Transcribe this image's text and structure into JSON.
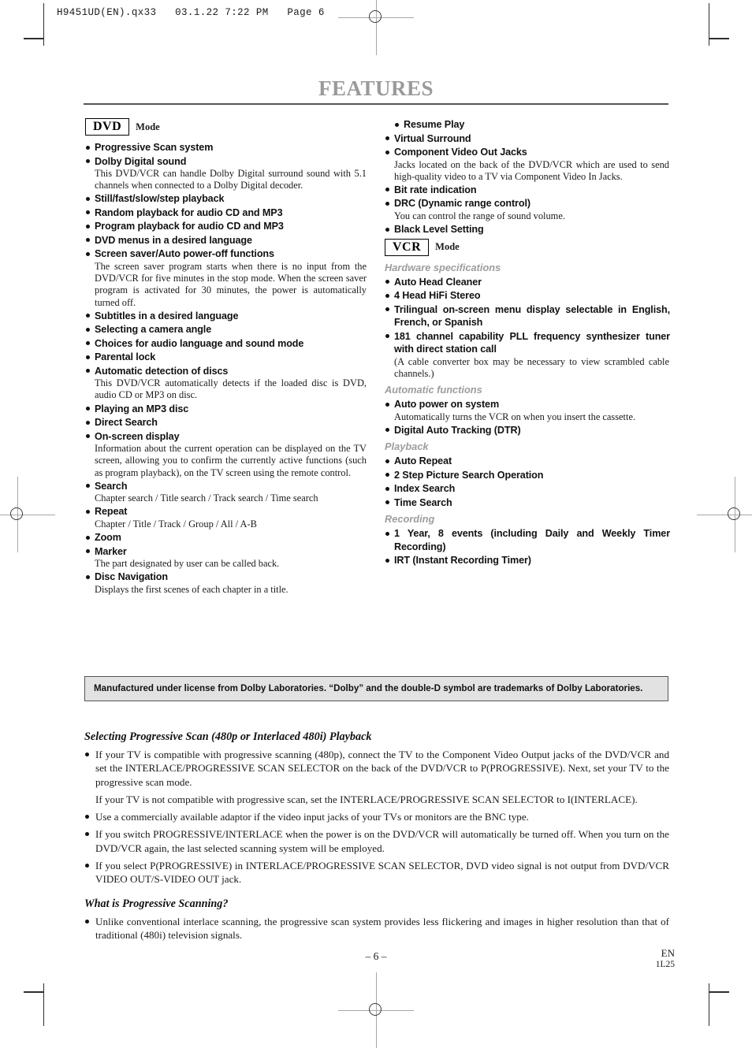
{
  "print_header": "H9451UD(EN).qx33   03.1.22 7:22 PM   Page 6",
  "page_title": "FEATURES",
  "colors": {
    "title_gray": "#9a9a9a",
    "group_label_gray": "#9d9d9d",
    "notice_bg": "#e2e2e2",
    "rule": "#555555"
  },
  "left_column": {
    "mode_badge": "DVD",
    "mode_word": "Mode",
    "items": [
      {
        "title": "Progressive Scan system"
      },
      {
        "title": "Dolby Digital sound",
        "desc": "This DVD/VCR can handle Dolby Digital surround sound with 5.1 channels when connected to a Dolby Digital decoder."
      },
      {
        "title": "Still/fast/slow/step playback"
      },
      {
        "title": "Random playback for audio CD and MP3"
      },
      {
        "title": "Program playback for audio CD and MP3"
      },
      {
        "title": "DVD menus in a desired language"
      },
      {
        "title": "Screen saver/Auto power-off functions",
        "desc": "The screen saver program starts when there is no input from the DVD/VCR for five minutes in the stop mode. When the screen saver program is activated for 30 minutes, the power is automatically turned off."
      },
      {
        "title": "Subtitles in a desired language"
      },
      {
        "title": "Selecting a camera angle"
      },
      {
        "title": "Choices for audio language and sound mode"
      },
      {
        "title": "Parental lock"
      },
      {
        "title": "Automatic detection of discs",
        "desc": "This DVD/VCR automatically detects if the loaded disc is DVD,  audio CD or MP3 on disc."
      },
      {
        "title": "Playing an MP3 disc"
      },
      {
        "title": "Direct Search"
      },
      {
        "title": "On-screen display",
        "desc": "Information about the current operation can be displayed on the TV screen, allowing you to confirm the currently active functions (such as program playback), on the TV screen using the remote control."
      },
      {
        "title": "Search",
        "desc": "Chapter search / Title search / Track search / Time search"
      },
      {
        "title": "Repeat",
        "desc": "Chapter / Title / Track / Group / All / A-B"
      },
      {
        "title": "Zoom"
      },
      {
        "title": "Marker",
        "desc": "The part designated by user can be called back."
      },
      {
        "title": "Disc Navigation",
        "desc": "Displays the first scenes of each chapter in a title."
      }
    ]
  },
  "right_column": {
    "dvd_continued": [
      {
        "title": "Resume Play",
        "indent": true
      },
      {
        "title": "Virtual Surround"
      },
      {
        "title": "Component Video Out Jacks",
        "desc": "Jacks located on the back of the DVD/VCR which are used to send high-quality video to a TV via Component Video In Jacks."
      },
      {
        "title": "Bit rate indication"
      },
      {
        "title": "DRC (Dynamic range control)",
        "desc": "You can control the range of sound volume."
      },
      {
        "title": "Black Level Setting"
      }
    ],
    "mode_badge": "VCR",
    "mode_word": "Mode",
    "groups": [
      {
        "label": "Hardware specifications",
        "items": [
          {
            "title": "Auto Head Cleaner"
          },
          {
            "title": "4 Head HiFi Stereo"
          },
          {
            "title": "Trilingual on-screen menu display selectable in English, French, or Spanish",
            "justify": true
          },
          {
            "title": "181 channel capability PLL frequency synthesizer tuner with direct station call",
            "justify": true,
            "desc": "(A cable converter box may be necessary to view scrambled cable channels.)"
          }
        ]
      },
      {
        "label": "Automatic functions",
        "items": [
          {
            "title": "Auto power on system",
            "desc": "Automatically turns the VCR on when you insert the cassette."
          },
          {
            "title": "Digital Auto Tracking (DTR)"
          }
        ]
      },
      {
        "label": "Playback",
        "items": [
          {
            "title": "Auto Repeat"
          },
          {
            "title": "2 Step Picture Search Operation"
          },
          {
            "title": "Index Search"
          },
          {
            "title": "Time Search"
          }
        ]
      },
      {
        "label": "Recording",
        "items": [
          {
            "title": "1 Year, 8 events (including Daily and Weekly Timer Recording)",
            "justify": true
          },
          {
            "title": "IRT (Instant Recording Timer)"
          }
        ]
      }
    ]
  },
  "dolby_notice": "Manufactured under license from Dolby Laboratories. “Dolby” and the double-D symbol are trademarks of Dolby Laboratories.",
  "progressive_section": {
    "heading": "Selecting Progressive Scan (480p or Interlaced 480i) Playback",
    "paragraphs": [
      {
        "bullet": true,
        "text": "If your TV is compatible with progressive scanning (480p), connect the TV to the Component Video Output jacks of the DVD/VCR and set the INTERLACE/PROGRESSIVE SCAN SELECTOR on the back of the DVD/VCR to P(PROGRESSIVE).  Next, set your TV to the progressive scan mode."
      },
      {
        "bullet": false,
        "text": "If your TV is not compatible with progressive scan, set the INTERLACE/PROGRESSIVE SCAN SELECTOR to I(INTERLACE)."
      },
      {
        "bullet": true,
        "text": "Use a commercially available adaptor if the video input jacks of your TVs or monitors are the BNC type."
      },
      {
        "bullet": true,
        "text": "If you switch PROGRESSIVE/INTERLACE when the power is on the DVD/VCR will automatically be turned off. When you turn on the DVD/VCR again, the last selected scanning system will be employed."
      },
      {
        "bullet": true,
        "text": "If you select P(PROGRESSIVE) in INTERLACE/PROGRESSIVE SCAN SELECTOR, DVD video signal is not output from DVD/VCR VIDEO OUT/S-VIDEO OUT jack."
      }
    ]
  },
  "what_is_section": {
    "heading": "What is Progressive Scanning?",
    "paragraphs": [
      {
        "bullet": true,
        "text": "Unlike conventional interlace scanning, the progressive scan system provides less flickering and images in higher resolution than that of traditional (480i) television signals."
      }
    ]
  },
  "footer": {
    "page_number": "– 6 –",
    "language_code": "EN",
    "doc_code": "1L25"
  }
}
